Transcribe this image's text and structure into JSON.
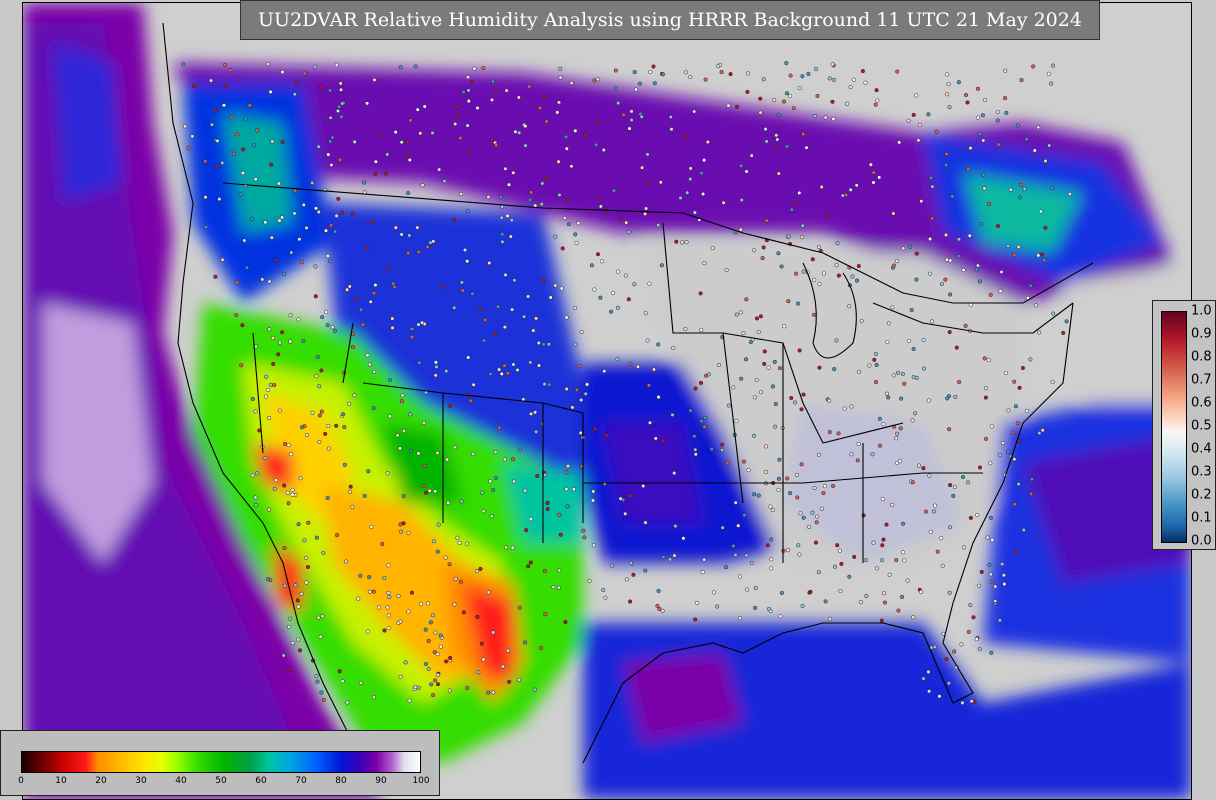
{
  "title": "UU2DVAR Relative Humidity Analysis using HRRR Background 11 UTC 21 May 2024",
  "colors": {
    "very_dry": "#ff1a1a",
    "dry": "#ffb400",
    "moderate": "#36dd00",
    "moist": "#00a8e0",
    "humid": "#0018d8",
    "saturated": "#7a00a8",
    "no_data": "#cfcfcf"
  },
  "rh_colorbar": {
    "min": 0,
    "max": 100,
    "ticks": [
      "0",
      "10",
      "20",
      "30",
      "40",
      "50",
      "60",
      "70",
      "80",
      "90",
      "100"
    ]
  },
  "gradient_colorbar": {
    "min": 0.0,
    "max": 1.0,
    "ticks": [
      "1.0",
      "0.9",
      "0.8",
      "0.7",
      "0.6",
      "0.5",
      "0.4",
      "0.3",
      "0.2",
      "0.1",
      "0.0"
    ]
  }
}
